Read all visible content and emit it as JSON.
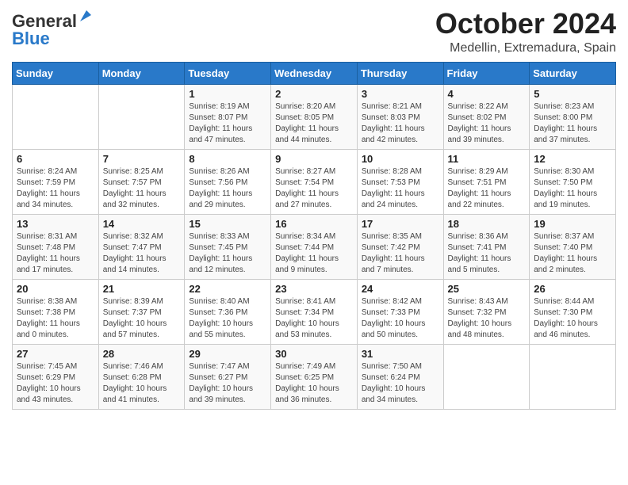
{
  "logo": {
    "general": "General",
    "blue": "Blue"
  },
  "title": "October 2024",
  "location": "Medellin, Extremadura, Spain",
  "days_of_week": [
    "Sunday",
    "Monday",
    "Tuesday",
    "Wednesday",
    "Thursday",
    "Friday",
    "Saturday"
  ],
  "weeks": [
    [
      {
        "day": "",
        "detail": ""
      },
      {
        "day": "",
        "detail": ""
      },
      {
        "day": "1",
        "detail": "Sunrise: 8:19 AM\nSunset: 8:07 PM\nDaylight: 11 hours\nand 47 minutes."
      },
      {
        "day": "2",
        "detail": "Sunrise: 8:20 AM\nSunset: 8:05 PM\nDaylight: 11 hours\nand 44 minutes."
      },
      {
        "day": "3",
        "detail": "Sunrise: 8:21 AM\nSunset: 8:03 PM\nDaylight: 11 hours\nand 42 minutes."
      },
      {
        "day": "4",
        "detail": "Sunrise: 8:22 AM\nSunset: 8:02 PM\nDaylight: 11 hours\nand 39 minutes."
      },
      {
        "day": "5",
        "detail": "Sunrise: 8:23 AM\nSunset: 8:00 PM\nDaylight: 11 hours\nand 37 minutes."
      }
    ],
    [
      {
        "day": "6",
        "detail": "Sunrise: 8:24 AM\nSunset: 7:59 PM\nDaylight: 11 hours\nand 34 minutes."
      },
      {
        "day": "7",
        "detail": "Sunrise: 8:25 AM\nSunset: 7:57 PM\nDaylight: 11 hours\nand 32 minutes."
      },
      {
        "day": "8",
        "detail": "Sunrise: 8:26 AM\nSunset: 7:56 PM\nDaylight: 11 hours\nand 29 minutes."
      },
      {
        "day": "9",
        "detail": "Sunrise: 8:27 AM\nSunset: 7:54 PM\nDaylight: 11 hours\nand 27 minutes."
      },
      {
        "day": "10",
        "detail": "Sunrise: 8:28 AM\nSunset: 7:53 PM\nDaylight: 11 hours\nand 24 minutes."
      },
      {
        "day": "11",
        "detail": "Sunrise: 8:29 AM\nSunset: 7:51 PM\nDaylight: 11 hours\nand 22 minutes."
      },
      {
        "day": "12",
        "detail": "Sunrise: 8:30 AM\nSunset: 7:50 PM\nDaylight: 11 hours\nand 19 minutes."
      }
    ],
    [
      {
        "day": "13",
        "detail": "Sunrise: 8:31 AM\nSunset: 7:48 PM\nDaylight: 11 hours\nand 17 minutes."
      },
      {
        "day": "14",
        "detail": "Sunrise: 8:32 AM\nSunset: 7:47 PM\nDaylight: 11 hours\nand 14 minutes."
      },
      {
        "day": "15",
        "detail": "Sunrise: 8:33 AM\nSunset: 7:45 PM\nDaylight: 11 hours\nand 12 minutes."
      },
      {
        "day": "16",
        "detail": "Sunrise: 8:34 AM\nSunset: 7:44 PM\nDaylight: 11 hours\nand 9 minutes."
      },
      {
        "day": "17",
        "detail": "Sunrise: 8:35 AM\nSunset: 7:42 PM\nDaylight: 11 hours\nand 7 minutes."
      },
      {
        "day": "18",
        "detail": "Sunrise: 8:36 AM\nSunset: 7:41 PM\nDaylight: 11 hours\nand 5 minutes."
      },
      {
        "day": "19",
        "detail": "Sunrise: 8:37 AM\nSunset: 7:40 PM\nDaylight: 11 hours\nand 2 minutes."
      }
    ],
    [
      {
        "day": "20",
        "detail": "Sunrise: 8:38 AM\nSunset: 7:38 PM\nDaylight: 11 hours\nand 0 minutes."
      },
      {
        "day": "21",
        "detail": "Sunrise: 8:39 AM\nSunset: 7:37 PM\nDaylight: 10 hours\nand 57 minutes."
      },
      {
        "day": "22",
        "detail": "Sunrise: 8:40 AM\nSunset: 7:36 PM\nDaylight: 10 hours\nand 55 minutes."
      },
      {
        "day": "23",
        "detail": "Sunrise: 8:41 AM\nSunset: 7:34 PM\nDaylight: 10 hours\nand 53 minutes."
      },
      {
        "day": "24",
        "detail": "Sunrise: 8:42 AM\nSunset: 7:33 PM\nDaylight: 10 hours\nand 50 minutes."
      },
      {
        "day": "25",
        "detail": "Sunrise: 8:43 AM\nSunset: 7:32 PM\nDaylight: 10 hours\nand 48 minutes."
      },
      {
        "day": "26",
        "detail": "Sunrise: 8:44 AM\nSunset: 7:30 PM\nDaylight: 10 hours\nand 46 minutes."
      }
    ],
    [
      {
        "day": "27",
        "detail": "Sunrise: 7:45 AM\nSunset: 6:29 PM\nDaylight: 10 hours\nand 43 minutes."
      },
      {
        "day": "28",
        "detail": "Sunrise: 7:46 AM\nSunset: 6:28 PM\nDaylight: 10 hours\nand 41 minutes."
      },
      {
        "day": "29",
        "detail": "Sunrise: 7:47 AM\nSunset: 6:27 PM\nDaylight: 10 hours\nand 39 minutes."
      },
      {
        "day": "30",
        "detail": "Sunrise: 7:49 AM\nSunset: 6:25 PM\nDaylight: 10 hours\nand 36 minutes."
      },
      {
        "day": "31",
        "detail": "Sunrise: 7:50 AM\nSunset: 6:24 PM\nDaylight: 10 hours\nand 34 minutes."
      },
      {
        "day": "",
        "detail": ""
      },
      {
        "day": "",
        "detail": ""
      }
    ]
  ]
}
